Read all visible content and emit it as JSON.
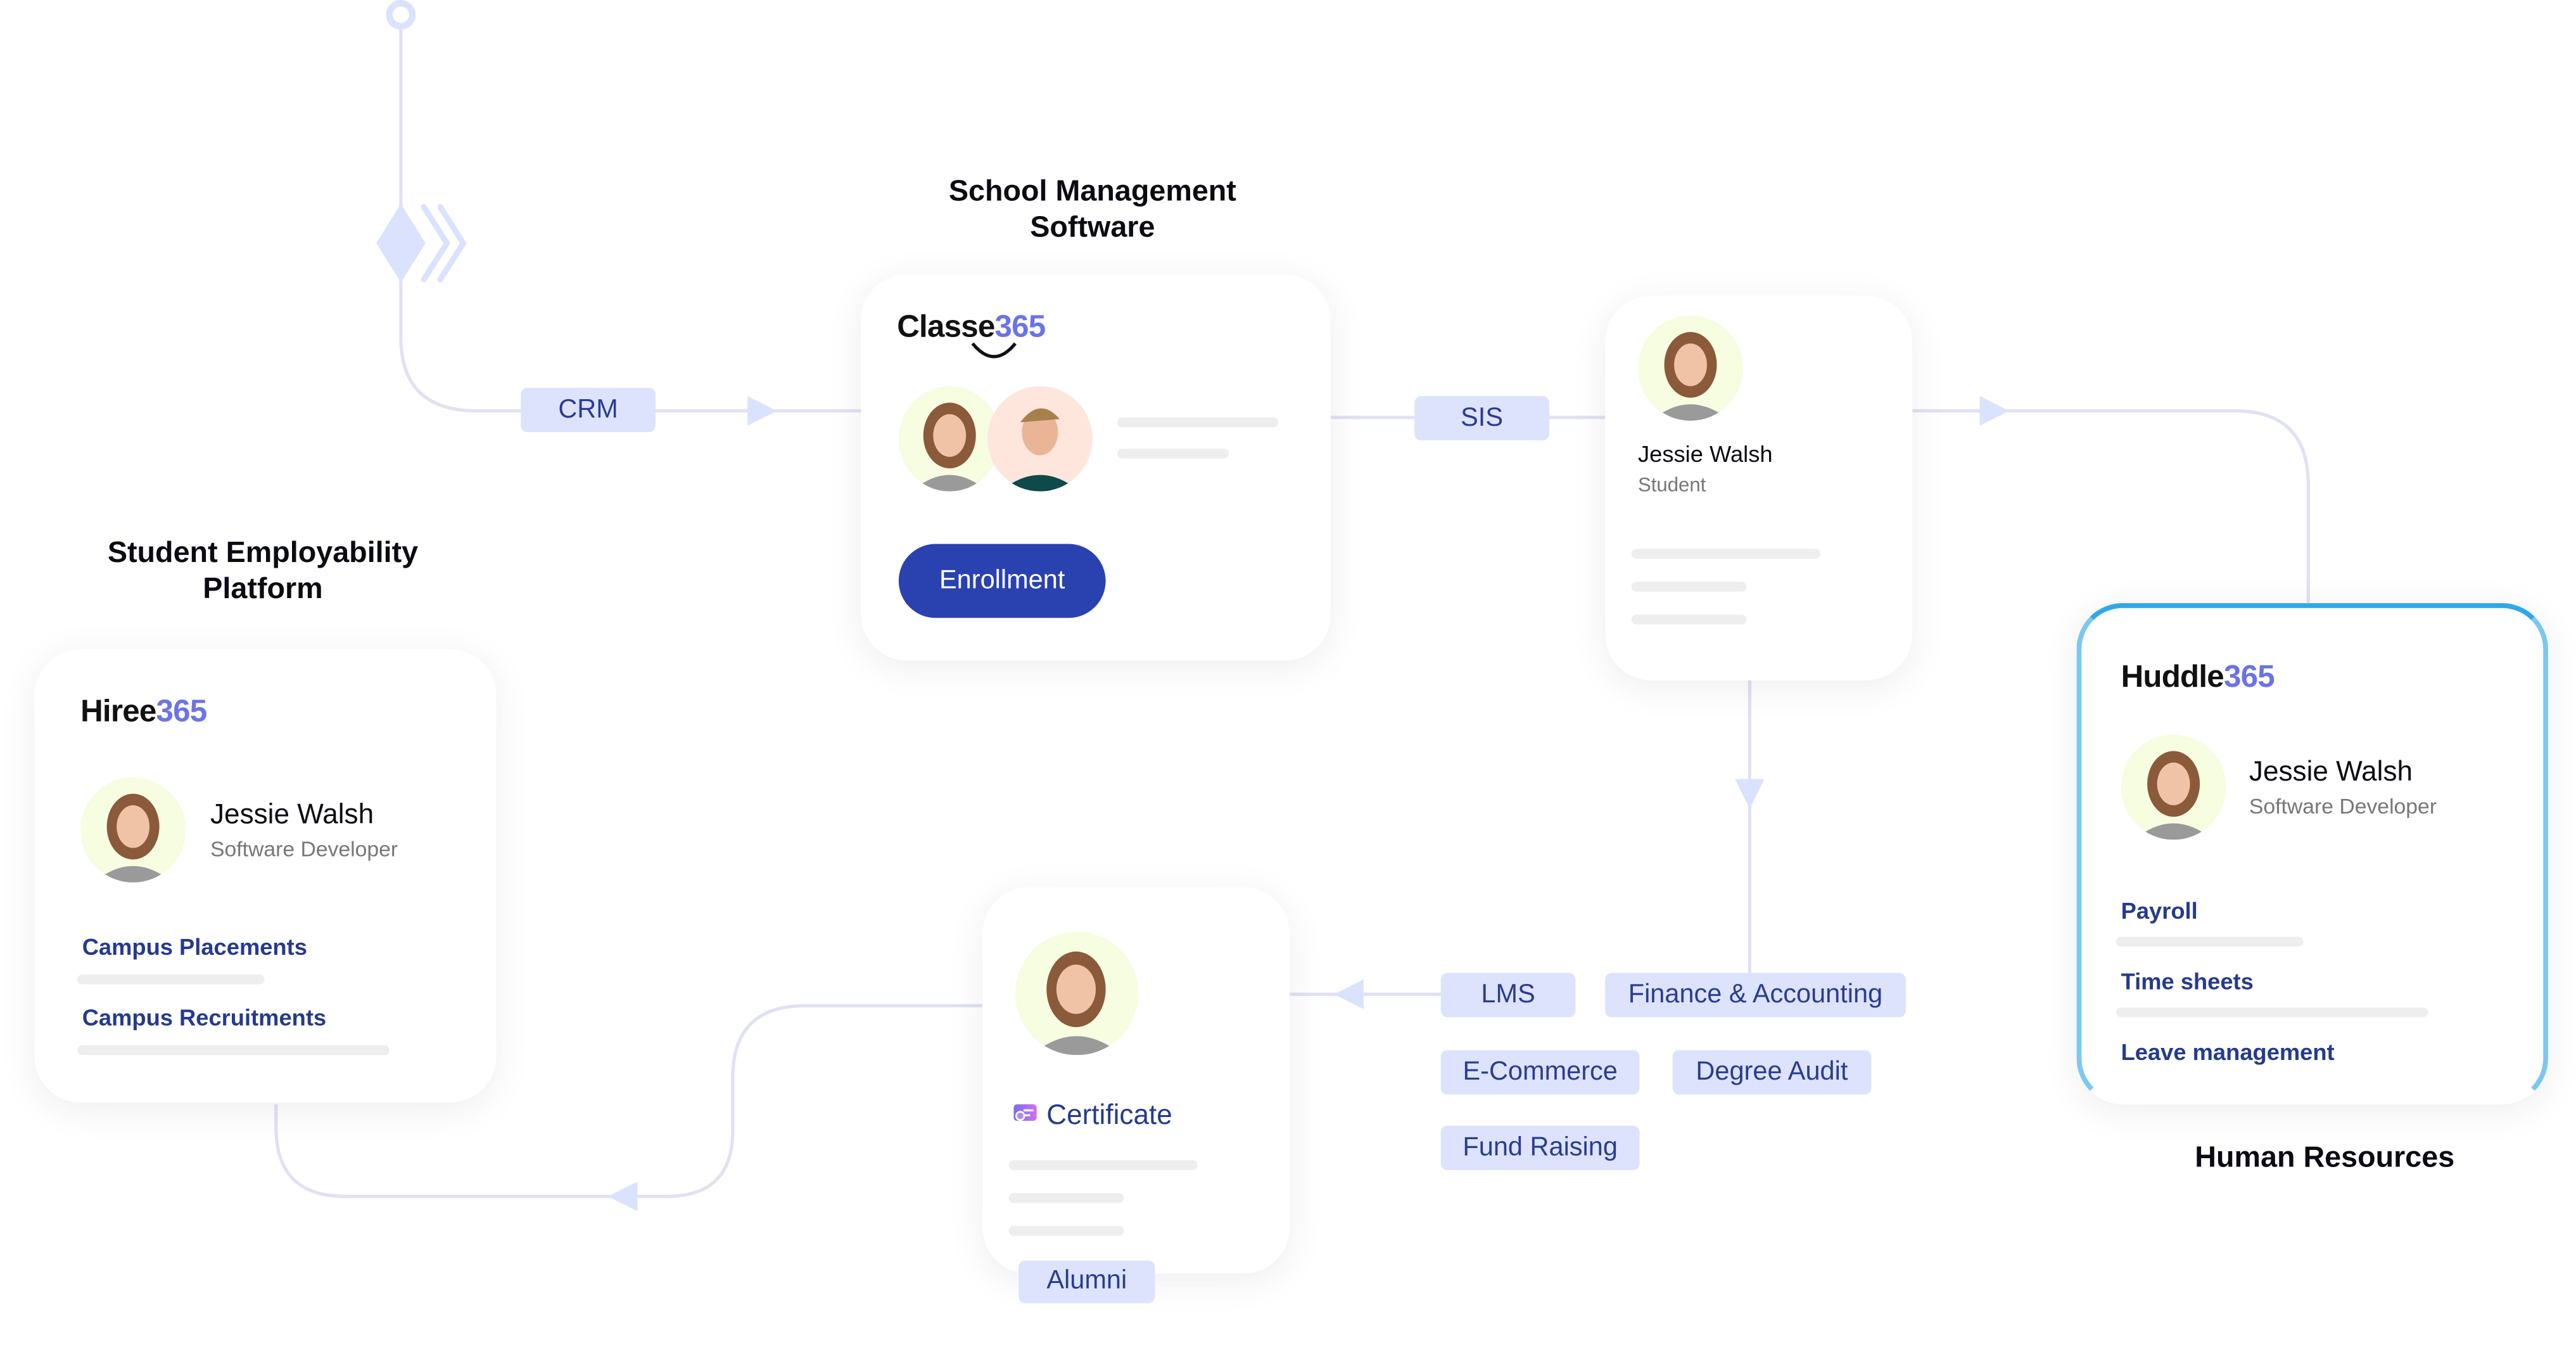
{
  "titles": {
    "school": "School Management Software",
    "employability": "Student Employability Platform",
    "hr": "Human Resources"
  },
  "connectors": {
    "crm": "CRM",
    "sis": "SIS",
    "alumni": "Alumni"
  },
  "classe": {
    "logo_text": "Classe",
    "logo_num": "365",
    "button": "Enrollment"
  },
  "student": {
    "name": "Jessie Walsh",
    "role": "Student"
  },
  "huddle": {
    "logo_text": "Huddle",
    "logo_num": "365",
    "name": "Jessie Walsh",
    "role": "Software Developer",
    "items": [
      "Payroll",
      "Time sheets",
      "Leave management"
    ]
  },
  "hiree": {
    "logo_text": "Hiree",
    "logo_num": "365",
    "name": "Jessie Walsh",
    "role": "Software Developer",
    "items": [
      "Campus Placements",
      "Campus Recruitments"
    ]
  },
  "certificate": {
    "label": "Certificate",
    "icon": "certificate-icon"
  },
  "modules": [
    "LMS",
    "Finance & Accounting",
    "E-Commerce",
    "Degree Audit",
    "Fund Raising"
  ],
  "colors": {
    "accent": "#2a41b0",
    "pill_bg": "#dde3fd",
    "pill_text": "#2a3d8f",
    "line": "#e0e1f2",
    "logo_number": "#6a73e8",
    "huddle_border": "#2fa9e8"
  }
}
